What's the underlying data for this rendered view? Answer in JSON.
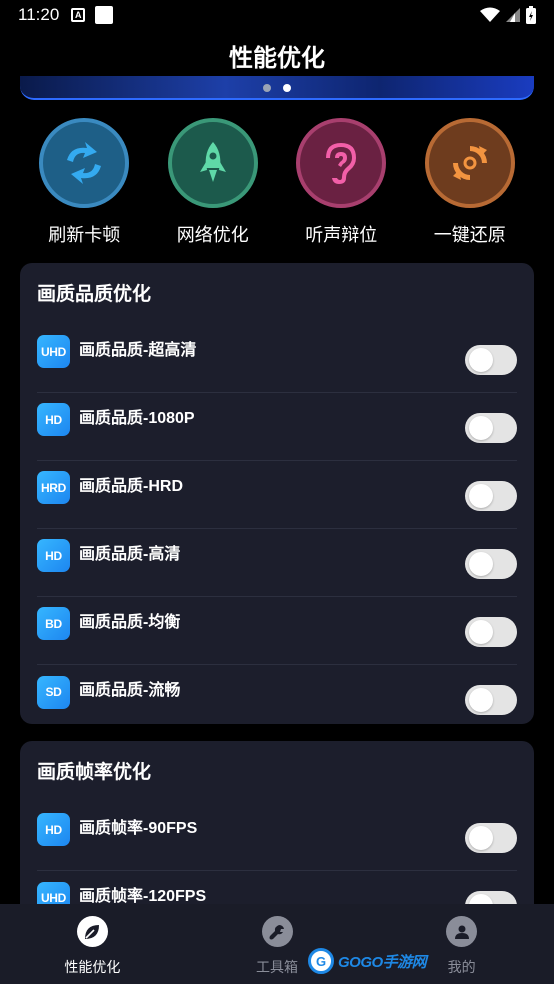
{
  "status": {
    "time": "11:20",
    "a_icon": "A"
  },
  "header": {
    "title": "性能优化"
  },
  "quick_actions": [
    {
      "label": "刷新卡顿",
      "icon": "refresh-arrows-icon",
      "color": "#3fa0e0"
    },
    {
      "label": "网络优化",
      "icon": "rocket-icon",
      "color": "#3aa882"
    },
    {
      "label": "听声辩位",
      "icon": "ear-icon",
      "color": "#c2407a"
    },
    {
      "label": "一键还原",
      "icon": "restore-icon",
      "color": "#d47a3c"
    }
  ],
  "quality_card": {
    "title": "画质品质优化",
    "items": [
      {
        "badge": "UHD",
        "label": "画质品质-超高清",
        "enabled": false
      },
      {
        "badge": "HD",
        "label": "画质品质-1080P",
        "enabled": false
      },
      {
        "badge": "HRD",
        "label": "画质品质-HRD",
        "enabled": false
      },
      {
        "badge": "HD",
        "label": "画质品质-高清",
        "enabled": false
      },
      {
        "badge": "BD",
        "label": "画质品质-均衡",
        "enabled": false
      },
      {
        "badge": "SD",
        "label": "画质品质-流畅",
        "enabled": false
      }
    ]
  },
  "framerate_card": {
    "title": "画质帧率优化",
    "items": [
      {
        "badge": "HD",
        "label": "画质帧率-90FPS",
        "enabled": false
      },
      {
        "badge": "UHD",
        "label": "画质帧率-120FPS",
        "enabled": false
      }
    ]
  },
  "bottom_nav": [
    {
      "label": "性能优化",
      "icon": "leaf-icon",
      "active": true
    },
    {
      "label": "工具箱",
      "icon": "wrench-icon",
      "active": false
    },
    {
      "label": "我的",
      "icon": "user-icon",
      "active": false
    }
  ],
  "watermark": {
    "logo": "G",
    "text": "GOGO手游网"
  },
  "colors": {
    "background": "#000000",
    "card": "#1c1e2c",
    "badge": "#2a9df4",
    "toggle_off": "#e4e4e4",
    "nav_active": "#ffffff",
    "nav_inactive": "#8a8d99"
  }
}
